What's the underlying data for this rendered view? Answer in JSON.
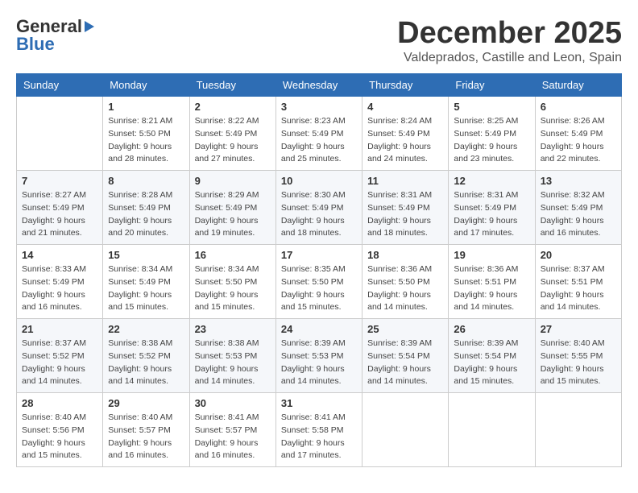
{
  "logo": {
    "general": "General",
    "blue": "Blue",
    "arrow": "▶"
  },
  "header": {
    "month": "December 2025",
    "location": "Valdeprados, Castille and Leon, Spain"
  },
  "weekdays": [
    "Sunday",
    "Monday",
    "Tuesday",
    "Wednesday",
    "Thursday",
    "Friday",
    "Saturday"
  ],
  "weeks": [
    [
      {
        "day": "",
        "info": ""
      },
      {
        "day": "1",
        "info": "Sunrise: 8:21 AM\nSunset: 5:50 PM\nDaylight: 9 hours\nand 28 minutes."
      },
      {
        "day": "2",
        "info": "Sunrise: 8:22 AM\nSunset: 5:49 PM\nDaylight: 9 hours\nand 27 minutes."
      },
      {
        "day": "3",
        "info": "Sunrise: 8:23 AM\nSunset: 5:49 PM\nDaylight: 9 hours\nand 25 minutes."
      },
      {
        "day": "4",
        "info": "Sunrise: 8:24 AM\nSunset: 5:49 PM\nDaylight: 9 hours\nand 24 minutes."
      },
      {
        "day": "5",
        "info": "Sunrise: 8:25 AM\nSunset: 5:49 PM\nDaylight: 9 hours\nand 23 minutes."
      },
      {
        "day": "6",
        "info": "Sunrise: 8:26 AM\nSunset: 5:49 PM\nDaylight: 9 hours\nand 22 minutes."
      }
    ],
    [
      {
        "day": "7",
        "info": "Sunrise: 8:27 AM\nSunset: 5:49 PM\nDaylight: 9 hours\nand 21 minutes."
      },
      {
        "day": "8",
        "info": "Sunrise: 8:28 AM\nSunset: 5:49 PM\nDaylight: 9 hours\nand 20 minutes."
      },
      {
        "day": "9",
        "info": "Sunrise: 8:29 AM\nSunset: 5:49 PM\nDaylight: 9 hours\nand 19 minutes."
      },
      {
        "day": "10",
        "info": "Sunrise: 8:30 AM\nSunset: 5:49 PM\nDaylight: 9 hours\nand 18 minutes."
      },
      {
        "day": "11",
        "info": "Sunrise: 8:31 AM\nSunset: 5:49 PM\nDaylight: 9 hours\nand 18 minutes."
      },
      {
        "day": "12",
        "info": "Sunrise: 8:31 AM\nSunset: 5:49 PM\nDaylight: 9 hours\nand 17 minutes."
      },
      {
        "day": "13",
        "info": "Sunrise: 8:32 AM\nSunset: 5:49 PM\nDaylight: 9 hours\nand 16 minutes."
      }
    ],
    [
      {
        "day": "14",
        "info": "Sunrise: 8:33 AM\nSunset: 5:49 PM\nDaylight: 9 hours\nand 16 minutes."
      },
      {
        "day": "15",
        "info": "Sunrise: 8:34 AM\nSunset: 5:49 PM\nDaylight: 9 hours\nand 15 minutes."
      },
      {
        "day": "16",
        "info": "Sunrise: 8:34 AM\nSunset: 5:50 PM\nDaylight: 9 hours\nand 15 minutes."
      },
      {
        "day": "17",
        "info": "Sunrise: 8:35 AM\nSunset: 5:50 PM\nDaylight: 9 hours\nand 15 minutes."
      },
      {
        "day": "18",
        "info": "Sunrise: 8:36 AM\nSunset: 5:50 PM\nDaylight: 9 hours\nand 14 minutes."
      },
      {
        "day": "19",
        "info": "Sunrise: 8:36 AM\nSunset: 5:51 PM\nDaylight: 9 hours\nand 14 minutes."
      },
      {
        "day": "20",
        "info": "Sunrise: 8:37 AM\nSunset: 5:51 PM\nDaylight: 9 hours\nand 14 minutes."
      }
    ],
    [
      {
        "day": "21",
        "info": "Sunrise: 8:37 AM\nSunset: 5:52 PM\nDaylight: 9 hours\nand 14 minutes."
      },
      {
        "day": "22",
        "info": "Sunrise: 8:38 AM\nSunset: 5:52 PM\nDaylight: 9 hours\nand 14 minutes."
      },
      {
        "day": "23",
        "info": "Sunrise: 8:38 AM\nSunset: 5:53 PM\nDaylight: 9 hours\nand 14 minutes."
      },
      {
        "day": "24",
        "info": "Sunrise: 8:39 AM\nSunset: 5:53 PM\nDaylight: 9 hours\nand 14 minutes."
      },
      {
        "day": "25",
        "info": "Sunrise: 8:39 AM\nSunset: 5:54 PM\nDaylight: 9 hours\nand 14 minutes."
      },
      {
        "day": "26",
        "info": "Sunrise: 8:39 AM\nSunset: 5:54 PM\nDaylight: 9 hours\nand 15 minutes."
      },
      {
        "day": "27",
        "info": "Sunrise: 8:40 AM\nSunset: 5:55 PM\nDaylight: 9 hours\nand 15 minutes."
      }
    ],
    [
      {
        "day": "28",
        "info": "Sunrise: 8:40 AM\nSunset: 5:56 PM\nDaylight: 9 hours\nand 15 minutes."
      },
      {
        "day": "29",
        "info": "Sunrise: 8:40 AM\nSunset: 5:57 PM\nDaylight: 9 hours\nand 16 minutes."
      },
      {
        "day": "30",
        "info": "Sunrise: 8:41 AM\nSunset: 5:57 PM\nDaylight: 9 hours\nand 16 minutes."
      },
      {
        "day": "31",
        "info": "Sunrise: 8:41 AM\nSunset: 5:58 PM\nDaylight: 9 hours\nand 17 minutes."
      },
      {
        "day": "",
        "info": ""
      },
      {
        "day": "",
        "info": ""
      },
      {
        "day": "",
        "info": ""
      }
    ]
  ]
}
